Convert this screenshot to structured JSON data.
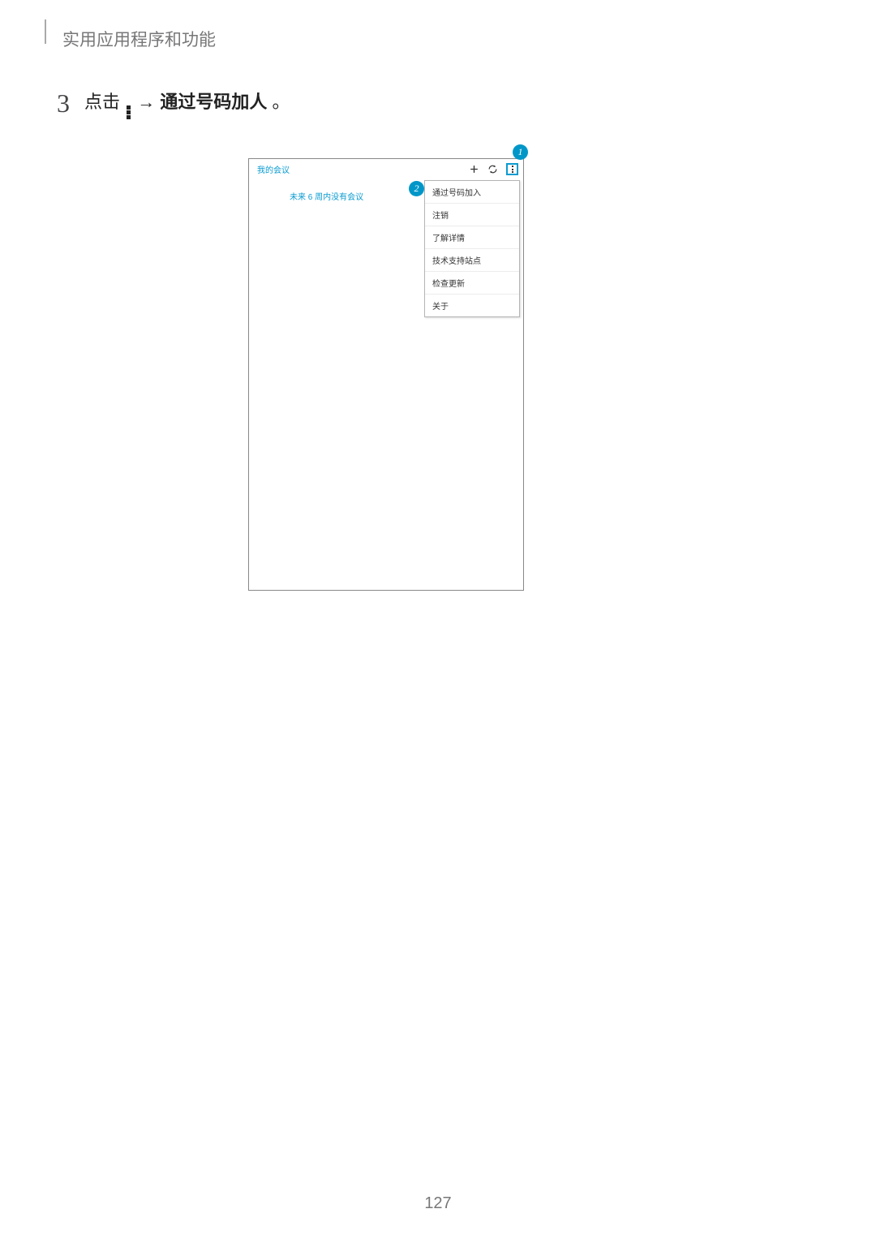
{
  "section_title": "实用应用程序和功能",
  "step": {
    "number": "3",
    "prefix": "点击 ",
    "arrow": " → ",
    "bold_text": "通过号码加人",
    "suffix": "。"
  },
  "phone": {
    "title": "我的会议",
    "empty_text": "未来 6 周内没有会议",
    "menu": [
      "通过号码加入",
      "注销",
      "了解详情",
      "技术支持站点",
      "检查更新",
      "关于"
    ]
  },
  "callouts": {
    "c1": "1",
    "c2": "2"
  },
  "page_number": "127"
}
